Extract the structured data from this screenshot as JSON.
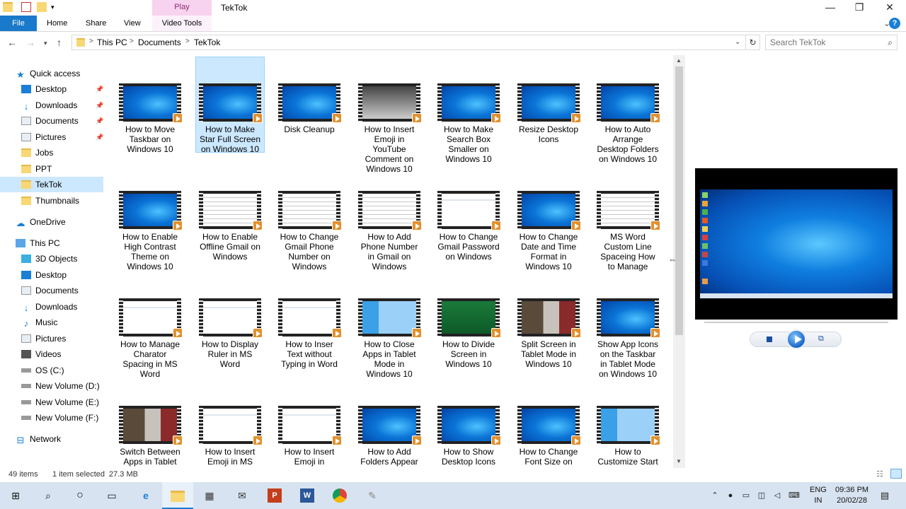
{
  "window": {
    "title": "TekTok",
    "play_context": "Play",
    "minimize": "—",
    "restore": "❐",
    "close": "✕"
  },
  "ribbon": {
    "tabs": [
      "File",
      "Home",
      "Share",
      "View",
      "Video Tools"
    ],
    "expand": "⌄",
    "help": "?"
  },
  "address": {
    "crumbs": [
      "This PC",
      "Documents",
      "TekTok"
    ],
    "separator": ">",
    "search_placeholder": "Search TekTok"
  },
  "sidebar": {
    "items": [
      {
        "label": "Quick access",
        "icon": "star-icon",
        "pinned": false
      },
      {
        "label": "Desktop",
        "icon": "desktop-icon",
        "pinned": true
      },
      {
        "label": "Downloads",
        "icon": "download-icon",
        "pinned": true
      },
      {
        "label": "Documents",
        "icon": "documents-icon",
        "pinned": true
      },
      {
        "label": "Pictures",
        "icon": "pictures-icon",
        "pinned": true
      },
      {
        "label": "Jobs",
        "icon": "folder-icon",
        "pinned": false
      },
      {
        "label": "PPT",
        "icon": "folder-icon",
        "pinned": false
      },
      {
        "label": "TekTok",
        "icon": "folder-icon",
        "pinned": false,
        "selected": true
      },
      {
        "label": "Thumbnails",
        "icon": "folder-icon",
        "pinned": false
      },
      {
        "label": "OneDrive",
        "icon": "cloud-icon",
        "pinned": false
      },
      {
        "label": "This PC",
        "icon": "computer-icon",
        "pinned": false
      },
      {
        "label": "3D Objects",
        "icon": "cube-icon",
        "pinned": false
      },
      {
        "label": "Desktop",
        "icon": "desktop-icon",
        "pinned": false
      },
      {
        "label": "Documents",
        "icon": "documents-icon",
        "pinned": false
      },
      {
        "label": "Downloads",
        "icon": "download-icon",
        "pinned": false
      },
      {
        "label": "Music",
        "icon": "music-icon",
        "pinned": false
      },
      {
        "label": "Pictures",
        "icon": "pictures-icon",
        "pinned": false
      },
      {
        "label": "Videos",
        "icon": "videos-icon",
        "pinned": false
      },
      {
        "label": "OS (C:)",
        "icon": "drive-icon",
        "pinned": false
      },
      {
        "label": "New Volume (D:)",
        "icon": "drive-icon",
        "pinned": false
      },
      {
        "label": "New Volume (E:)",
        "icon": "drive-icon",
        "pinned": false
      },
      {
        "label": "New Volume (F:)",
        "icon": "drive-icon",
        "pinned": false
      },
      {
        "label": "Network",
        "icon": "network-icon",
        "pinned": false
      }
    ]
  },
  "files": [
    {
      "label": "How to Move Taskbar on Windows 10",
      "thumb": "blue"
    },
    {
      "label": "How to Make Star Full Screen on Windows 10",
      "thumb": "blue",
      "selected": true
    },
    {
      "label": "Disk Cleanup",
      "thumb": "blue"
    },
    {
      "label": "How to Insert Emoji in YouTube Comment on Windows 10",
      "thumb": "dark"
    },
    {
      "label": "How to Make Search Box Smaller on Windows 10",
      "thumb": "blue"
    },
    {
      "label": "Resize Desktop Icons",
      "thumb": "blue"
    },
    {
      "label": "How to Auto Arrange Desktop Folders on Windows 10",
      "thumb": "blue"
    },
    {
      "label": "How to Enable High Contrast Theme on Windows 10",
      "thumb": "blue"
    },
    {
      "label": "How to Enable Offline Gmail on Windows",
      "thumb": "doc2"
    },
    {
      "label": "How to Change Gmail Phone Number on Windows",
      "thumb": "doc2"
    },
    {
      "label": "How to Add Phone Number in Gmail on Windows",
      "thumb": "doc2"
    },
    {
      "label": "How to Change Gmail Password on Windows",
      "thumb": "doc"
    },
    {
      "label": "How to Change Date and Time Format in Windows 10",
      "thumb": "blue"
    },
    {
      "label": "MS Word Custom Line Spaceing How to Manage",
      "thumb": "doc2"
    },
    {
      "label": "How to Manage Charator Spacing in MS Word",
      "thumb": "doc"
    },
    {
      "label": "How to Display Ruler in MS Word",
      "thumb": "doc"
    },
    {
      "label": "How to Inser Text without Typing in Word",
      "thumb": "doc"
    },
    {
      "label": "How to Close Apps in Tablet Mode in Windows 10",
      "thumb": "tablet"
    },
    {
      "label": "How to Divide Screen in Windows 10",
      "thumb": "green"
    },
    {
      "label": "Split Screen in Tablet Mode in Windows 10",
      "thumb": "photo"
    },
    {
      "label": "Show App Icons on the Taskbar in Tablet Mode on Windows 10",
      "thumb": "blue"
    },
    {
      "label": "Switch Between Apps in Tablet",
      "thumb": "photo"
    },
    {
      "label": "How to Insert Emoji in MS",
      "thumb": "doc"
    },
    {
      "label": "How to Insert Emoji in",
      "thumb": "doc"
    },
    {
      "label": "How to Add Folders Appear",
      "thumb": "blue"
    },
    {
      "label": "How to Show Desktop Icons on",
      "thumb": "blue"
    },
    {
      "label": "How to Change Font Size on",
      "thumb": "blue"
    },
    {
      "label": "How to Customize Start",
      "thumb": "tablet"
    }
  ],
  "status": {
    "count": "49 items",
    "selection": "1 item selected",
    "size": "27.3 MB"
  },
  "tray": {
    "lang_top": "ENG",
    "lang_bottom": "IN",
    "time": "09:36 PM",
    "date": "20/02/28"
  }
}
